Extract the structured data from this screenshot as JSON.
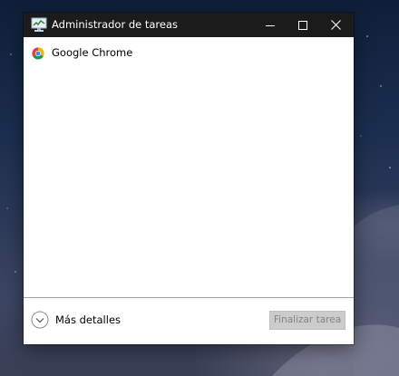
{
  "window": {
    "title": "Administrador de tareas",
    "controls": {
      "minimize": "minimize-icon",
      "maximize": "maximize-icon",
      "close": "close-icon"
    }
  },
  "processes": [
    {
      "name": "Google Chrome",
      "icon": "chrome-icon"
    }
  ],
  "footer": {
    "more_details_label": "Más detalles",
    "end_task_label": "Finalizar tarea",
    "end_task_enabled": false
  },
  "colors": {
    "titlebar": "#1b1b1b",
    "window_bg": "#ffffff",
    "disabled_button_bg": "#cccccc",
    "disabled_button_text": "#838383"
  }
}
